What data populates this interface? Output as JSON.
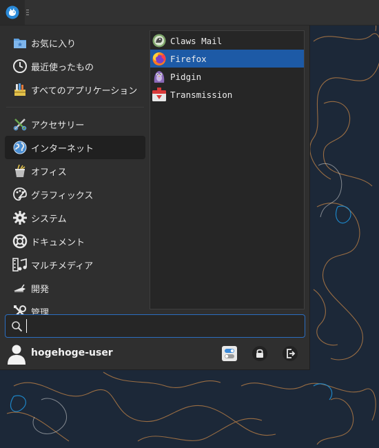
{
  "panel": {
    "menu_icon": "xfce-mouse-logo-icon"
  },
  "menu": {
    "categories": [
      {
        "label": "お気に入り",
        "icon": "favorites-folder-icon"
      },
      {
        "label": "最近使ったもの",
        "icon": "recent-clock-icon"
      },
      {
        "label": "すべてのアプリケーション",
        "icon": "all-applications-icon"
      },
      {
        "label": "アクセサリー",
        "icon": "accessories-icon"
      },
      {
        "label": "インターネット",
        "icon": "internet-globe-icon",
        "selected": true
      },
      {
        "label": "オフィス",
        "icon": "office-icon"
      },
      {
        "label": "グラフィックス",
        "icon": "graphics-palette-icon"
      },
      {
        "label": "システム",
        "icon": "system-gear-icon"
      },
      {
        "label": "ドキュメント",
        "icon": "documentation-lifebuoy-icon"
      },
      {
        "label": "マルチメディア",
        "icon": "multimedia-icon"
      },
      {
        "label": "開発",
        "icon": "development-icon"
      },
      {
        "label": "管理",
        "icon": "settings-tools-icon"
      }
    ],
    "apps": [
      {
        "label": "Claws Mail",
        "icon": "claws-mail-icon"
      },
      {
        "label": "Firefox",
        "icon": "firefox-icon",
        "selected": true
      },
      {
        "label": "Pidgin",
        "icon": "pidgin-icon"
      },
      {
        "label": "Transmission",
        "icon": "transmission-icon"
      }
    ],
    "search": {
      "value": "",
      "placeholder": ""
    },
    "user": {
      "name": "hogehoge-user"
    },
    "actions": [
      {
        "name": "settings-manager",
        "icon": "toggle-switches-icon"
      },
      {
        "name": "lock-screen",
        "icon": "lock-icon"
      },
      {
        "name": "log-out",
        "icon": "log-out-icon"
      }
    ]
  },
  "colors": {
    "selection": "#1d5aa6",
    "menu_bg": "#2f2f2f",
    "wallpaper_bg": "#1c2838",
    "contour_orange": "#c9884a",
    "contour_blue": "#1e8fd6"
  }
}
